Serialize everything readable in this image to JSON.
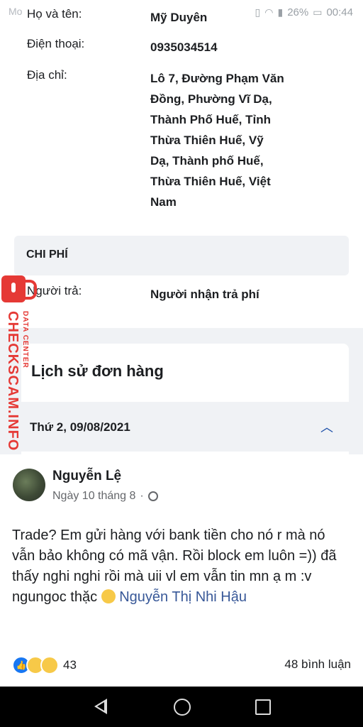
{
  "status_bar": {
    "carrier": "Mo",
    "battery": "26%",
    "time": "00:44"
  },
  "recipient": {
    "name_label": "Họ và tên:",
    "name_value": "Mỹ Duyên",
    "phone_label": "Điện thoại:",
    "phone_value": "0935034514",
    "address_label": "Địa chỉ:",
    "address_lines": [
      "Lô 7, Đường Phạm Văn",
      "Đồng, Phường Vĩ Dạ,",
      "Thành Phố Huế, Tỉnh",
      "Thừa Thiên Huế, Vỹ",
      "Dạ, Thành phố Huế,",
      "Thừa Thiên Huế, Việt",
      "Nam"
    ]
  },
  "cost": {
    "section_title": "CHI PHÍ",
    "payer_label": "Người trả:",
    "payer_value": "Người nhận trả phí"
  },
  "history": {
    "title": "Lịch sử đơn hàng",
    "date": "Thứ 2, 09/08/2021"
  },
  "watermark": {
    "main": "CHECKSCAM.INFO",
    "sub": "DATA CENTER"
  },
  "post": {
    "author": "Nguyễn Lệ",
    "time": "Ngày 10 tháng 8",
    "separator": "·",
    "text": "Trade? Em gửi hàng với bank tiền cho nó r mà nó vẫn bảo không có mã vận. Rồi block em luôn =)) đã thấy nghi nghi rồi mà uii vl em vẫn tin mn ạ m :v ngungoc thặc",
    "mention": "Nguyễn Thị Nhi Hậu",
    "reaction_count": "43",
    "comments": "48 bình luận"
  },
  "icons": {
    "status": [
      "vibrate-icon",
      "wifi-icon",
      "signal-icon",
      "battery-icon"
    ],
    "reactions": [
      "like-reaction-icon",
      "sad-reaction-icon",
      "haha-reaction-icon"
    ],
    "nav": [
      "back-icon",
      "home-icon",
      "recent-apps-icon"
    ]
  },
  "colors": {
    "accent": "#1877f2",
    "mention": "#385898",
    "watermark": "#e53935"
  }
}
